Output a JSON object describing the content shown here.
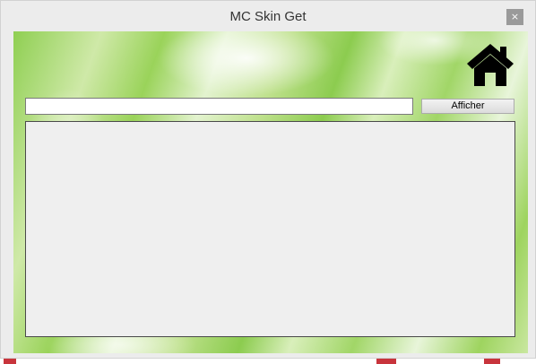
{
  "window": {
    "title": "MC Skin Get",
    "close_glyph": "×"
  },
  "toolbar": {
    "home_icon": "home-icon",
    "search_value": "",
    "show_label": "Afficher"
  },
  "output": {
    "content": ""
  },
  "colors": {
    "window_bg": "#ececec",
    "panel_bg": "#efefef",
    "accent_green": "#8fcf52",
    "close_bg": "#9a9a9a"
  }
}
